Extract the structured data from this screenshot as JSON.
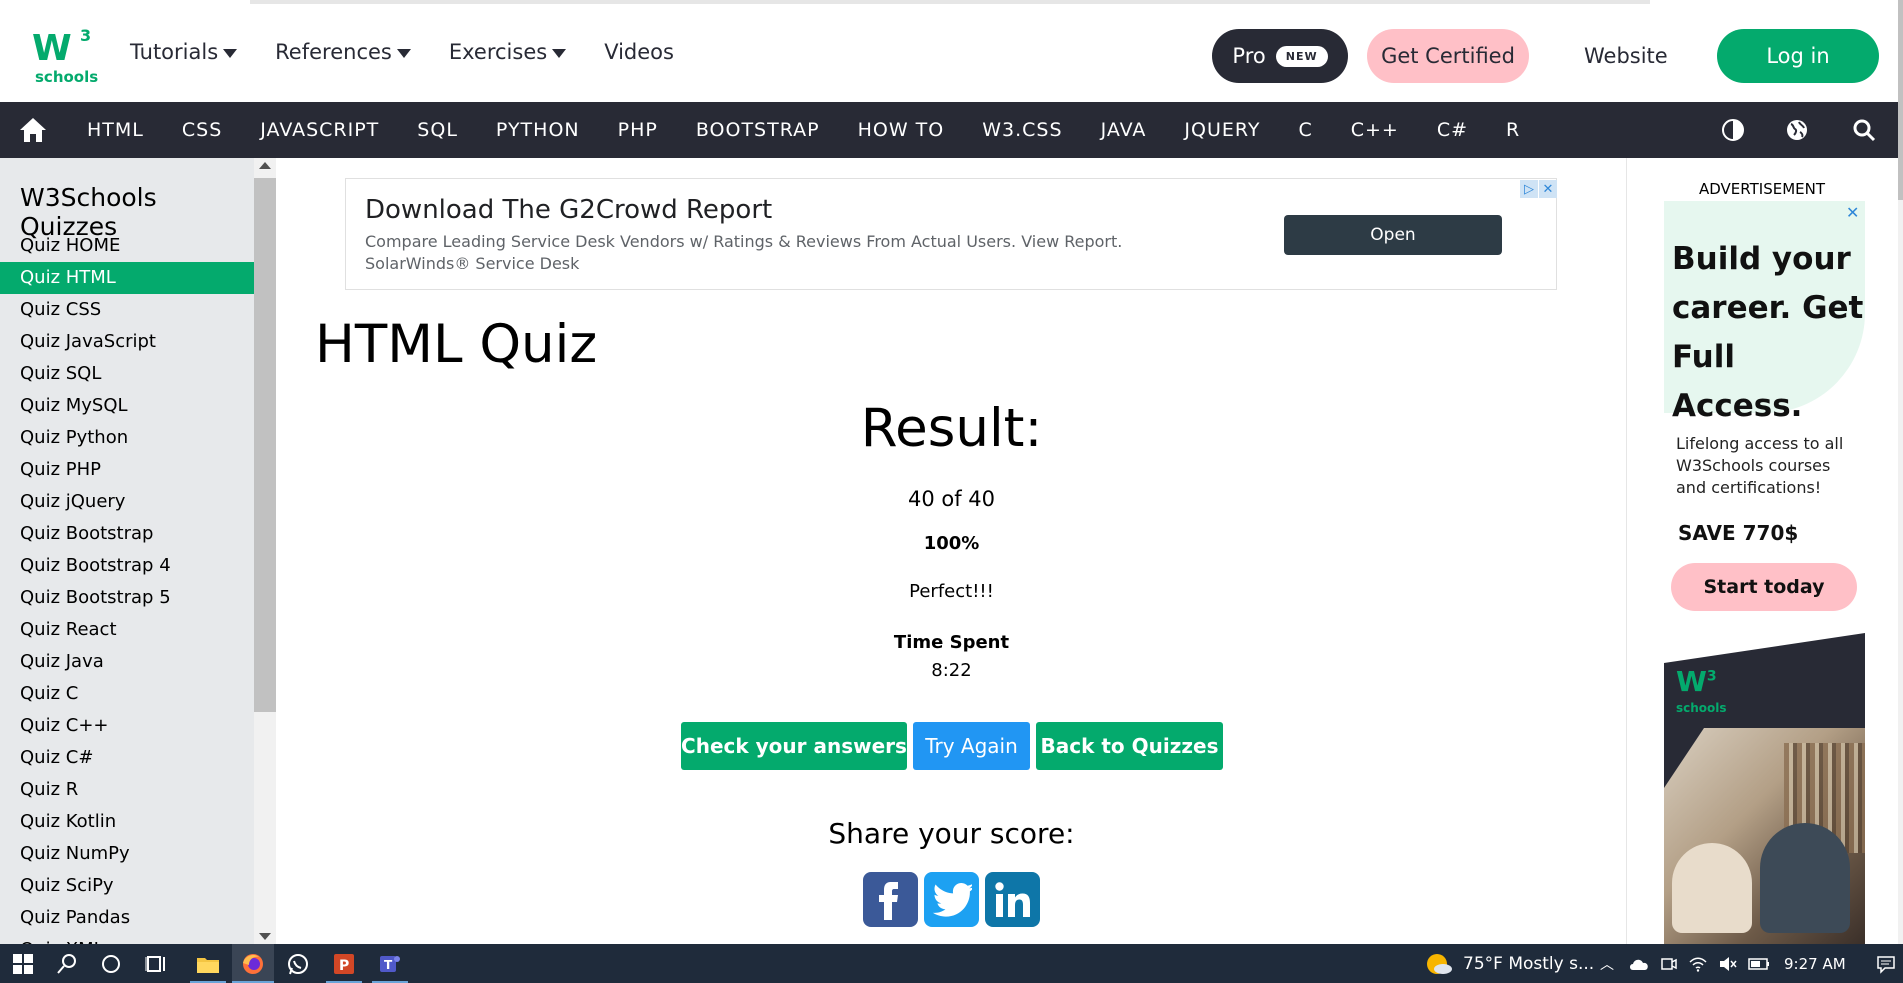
{
  "header": {
    "logo": {
      "mark": "W",
      "sup": "3",
      "text": "schools"
    },
    "nav": [
      {
        "label": "Tutorials",
        "has_caret": true
      },
      {
        "label": "References",
        "has_caret": true
      },
      {
        "label": "Exercises",
        "has_caret": true
      },
      {
        "label": "Videos",
        "has_caret": false
      }
    ],
    "pro_label": "Pro",
    "pro_badge": "NEW",
    "certified_label": "Get Certified",
    "website_label": "Website",
    "login_label": "Log in"
  },
  "topics": [
    "HTML",
    "CSS",
    "JAVASCRIPT",
    "SQL",
    "PYTHON",
    "PHP",
    "BOOTSTRAP",
    "HOW TO",
    "W3.CSS",
    "JAVA",
    "JQUERY",
    "C",
    "C++",
    "C#",
    "R"
  ],
  "sidebar": {
    "title": "W3Schools Quizzes",
    "items": [
      "Quiz HOME",
      "Quiz HTML",
      "Quiz CSS",
      "Quiz JavaScript",
      "Quiz SQL",
      "Quiz MySQL",
      "Quiz Python",
      "Quiz PHP",
      "Quiz jQuery",
      "Quiz Bootstrap",
      "Quiz Bootstrap 4",
      "Quiz Bootstrap 5",
      "Quiz React",
      "Quiz Java",
      "Quiz C",
      "Quiz C++",
      "Quiz C#",
      "Quiz R",
      "Quiz Kotlin",
      "Quiz NumPy",
      "Quiz SciPy",
      "Quiz Pandas",
      "Quiz XML"
    ],
    "active_index": 1
  },
  "ad_banner": {
    "title": "Download The G2Crowd Report",
    "description": "Compare Leading Service Desk Vendors w/ Ratings & Reviews From Actual Users. View Report. SolarWinds® Service Desk",
    "button": "Open"
  },
  "main": {
    "title": "HTML Quiz",
    "result_heading": "Result:",
    "score": "40 of 40",
    "percent": "100%",
    "message": "Perfect!!!",
    "time_label": "Time Spent",
    "time_value": "8:22",
    "buttons": {
      "check": "Check your answers",
      "again": "Try Again",
      "back": "Back to Quizzes"
    },
    "share_label": "Share your score:"
  },
  "right_ad": {
    "label": "ADVERTISEMENT",
    "headline": "Build your career. Get Full Access.",
    "subtext": "Lifelong access to all W3Schools courses and certifications!",
    "save": "SAVE 770$",
    "cta": "Start today",
    "logo_mark": "W",
    "logo_sup": "3",
    "logo_text": "schools"
  },
  "taskbar": {
    "weather": "75°F  Mostly s...",
    "time": "9:27 AM"
  },
  "colors": {
    "brand_green": "#04aa6d",
    "dark_nav": "#282a35",
    "pink": "#ffc0c7",
    "blue": "#2196f3",
    "facebook": "#3b5998",
    "twitter": "#1da1f2",
    "linkedin": "#0e76a8"
  }
}
